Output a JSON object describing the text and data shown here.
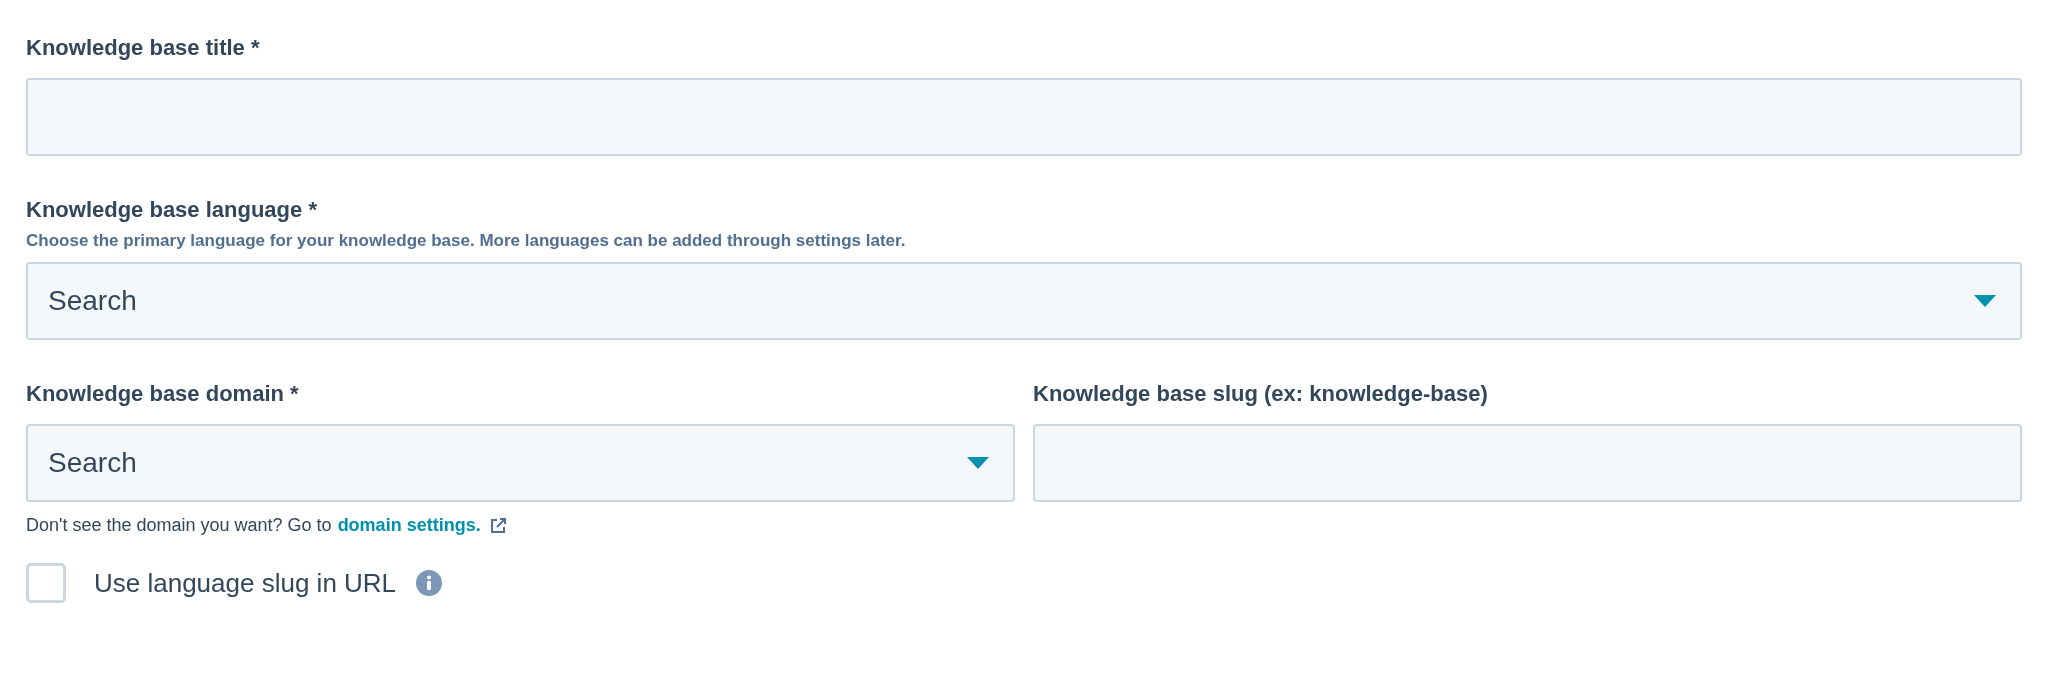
{
  "fields": [
    {
      "kind": "text",
      "label": "Knowledge base title *"
    },
    {
      "kind": "select",
      "label": "Knowledge base language *",
      "help": "Choose the primary language for your knowledge base. More languages can be added through settings later.",
      "value": "Search"
    }
  ],
  "domain_row": [
    {
      "kind": "select",
      "label": "Knowledge base domain *",
      "value": "Search"
    },
    {
      "kind": "text",
      "label": "Knowledge base slug (ex: knowledge-base)"
    }
  ],
  "domain_note": {
    "text": "Don't see the domain you want? Go to",
    "link": "domain settings."
  },
  "checkbox": {
    "label": "Use language slug in URL",
    "checked": false
  }
}
